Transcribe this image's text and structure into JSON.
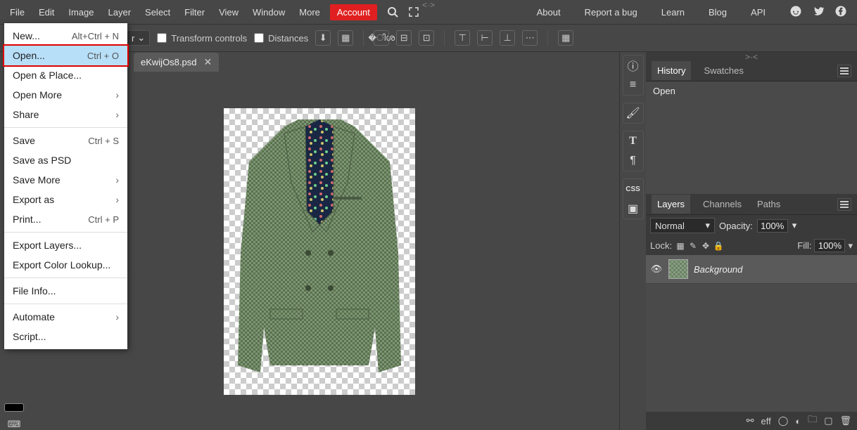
{
  "menubar": {
    "items": [
      "File",
      "Edit",
      "Image",
      "Layer",
      "Select",
      "Filter",
      "View",
      "Window",
      "More"
    ],
    "account": "Account",
    "right": [
      "About",
      "Report a bug",
      "Learn",
      "Blog",
      "API"
    ]
  },
  "toolbar": {
    "transform": "Transform controls",
    "distances": "Distances"
  },
  "document": {
    "tab": "eKwijOs8.psd"
  },
  "dropdown": {
    "items": [
      {
        "label": "New...",
        "shortcut": "Alt+Ctrl + N",
        "highlight": false,
        "sub": false
      },
      {
        "label": "Open...",
        "shortcut": "Ctrl + O",
        "highlight": true,
        "sub": false
      },
      {
        "label": "Open & Place...",
        "shortcut": "",
        "highlight": false,
        "sub": false
      },
      {
        "label": "Open More",
        "shortcut": "",
        "highlight": false,
        "sub": true
      },
      {
        "label": "Share",
        "shortcut": "",
        "highlight": false,
        "sub": true,
        "sep": true
      },
      {
        "label": "Save",
        "shortcut": "Ctrl + S",
        "highlight": false,
        "sub": false
      },
      {
        "label": "Save as PSD",
        "shortcut": "",
        "highlight": false,
        "sub": false
      },
      {
        "label": "Save More",
        "shortcut": "",
        "highlight": false,
        "sub": true
      },
      {
        "label": "Export as",
        "shortcut": "",
        "highlight": false,
        "sub": true
      },
      {
        "label": "Print...",
        "shortcut": "Ctrl + P",
        "highlight": false,
        "sub": false,
        "sep": true
      },
      {
        "label": "Export Layers...",
        "shortcut": "",
        "highlight": false,
        "sub": false
      },
      {
        "label": "Export Color Lookup...",
        "shortcut": "",
        "highlight": false,
        "sub": false,
        "sep": true
      },
      {
        "label": "File Info...",
        "shortcut": "",
        "highlight": false,
        "sub": false,
        "sep": true
      },
      {
        "label": "Automate",
        "shortcut": "",
        "highlight": false,
        "sub": true
      },
      {
        "label": "Script...",
        "shortcut": "",
        "highlight": false,
        "sub": false
      }
    ]
  },
  "panels": {
    "history": {
      "tabs": [
        "History",
        "Swatches"
      ],
      "items": [
        "Open"
      ]
    },
    "layers": {
      "tabs": [
        "Layers",
        "Channels",
        "Paths"
      ],
      "blend": "Normal",
      "opacity_label": "Opacity:",
      "opacity": "100%",
      "lock_label": "Lock:",
      "fill_label": "Fill:",
      "fill": "100%",
      "rows": [
        {
          "name": "Background"
        }
      ],
      "footer_eff": "eff"
    }
  },
  "handle_left": "<·>",
  "handle_right": ">·<"
}
